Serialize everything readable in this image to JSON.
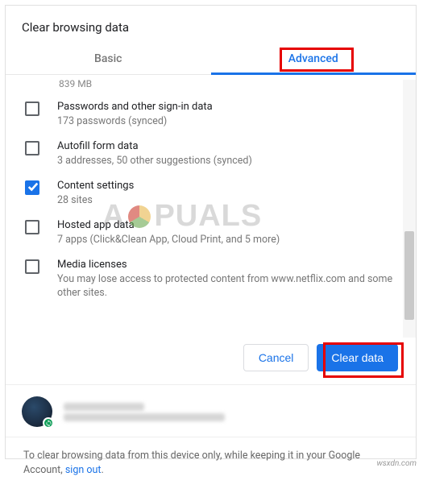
{
  "dialog": {
    "title": "Clear browsing data",
    "tabs": {
      "basic": "Basic",
      "advanced": "Advanced",
      "active": "advanced"
    },
    "truncated_top": "839 MB",
    "items": [
      {
        "checked": false,
        "title": "Passwords and other sign-in data",
        "sub": "173 passwords (synced)"
      },
      {
        "checked": false,
        "title": "Autofill form data",
        "sub": "3 addresses, 50 other suggestions (synced)"
      },
      {
        "checked": true,
        "title": "Content settings",
        "sub": "28 sites"
      },
      {
        "checked": false,
        "title": "Hosted app data",
        "sub": "7 apps (Click&Clean App, Cloud Print, and 5 more)"
      },
      {
        "checked": false,
        "title": "Media licenses",
        "sub": "You may lose access to protected content from www.netflix.com and some other sites."
      }
    ],
    "buttons": {
      "cancel": "Cancel",
      "clear": "Clear data"
    },
    "footer": {
      "text_a": "To clear browsing data from this device only, while keeping it in your Google Account, ",
      "link": "sign out",
      "text_b": "."
    }
  },
  "watermark": {
    "left": "A",
    "right": "PUALS"
  },
  "attribution": "wsxdn.com"
}
